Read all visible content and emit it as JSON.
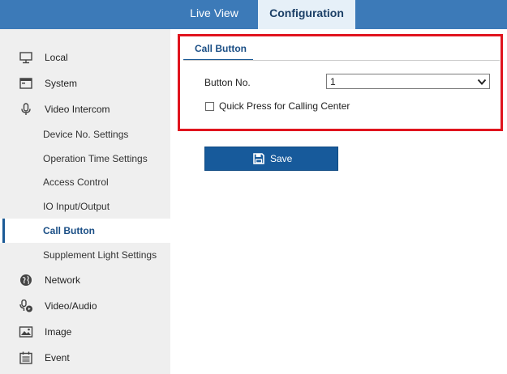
{
  "topnav": {
    "live_view": "Live View",
    "configuration": "Configuration"
  },
  "sidebar": {
    "items": [
      {
        "label": "Local",
        "icon": "monitor-icon"
      },
      {
        "label": "System",
        "icon": "system-window-icon"
      },
      {
        "label": "Video Intercom",
        "icon": "microphone-icon"
      },
      {
        "label": "Network",
        "icon": "globe-icon"
      },
      {
        "label": "Video/Audio",
        "icon": "mic-video-icon"
      },
      {
        "label": "Image",
        "icon": "image-icon"
      },
      {
        "label": "Event",
        "icon": "calendar-icon"
      }
    ],
    "subitems": [
      {
        "label": "Device No. Settings"
      },
      {
        "label": "Operation Time Settings"
      },
      {
        "label": "Access Control"
      },
      {
        "label": "IO Input/Output"
      },
      {
        "label": "Call Button",
        "active": true
      },
      {
        "label": "Supplement Light Settings"
      }
    ]
  },
  "content": {
    "tab_label": "Call Button",
    "button_no_label": "Button No.",
    "button_no_value": "1",
    "quick_press_label": "Quick Press for Calling Center",
    "quick_press_checked": false,
    "save_label": "Save"
  },
  "colors": {
    "topbar": "#3c7ab8",
    "active_tab_bg": "#e6f0f8",
    "sidebar_bg": "#efefef",
    "accent": "#1b5a96",
    "highlight_border": "#e0141e",
    "save_button": "#175a9b"
  }
}
